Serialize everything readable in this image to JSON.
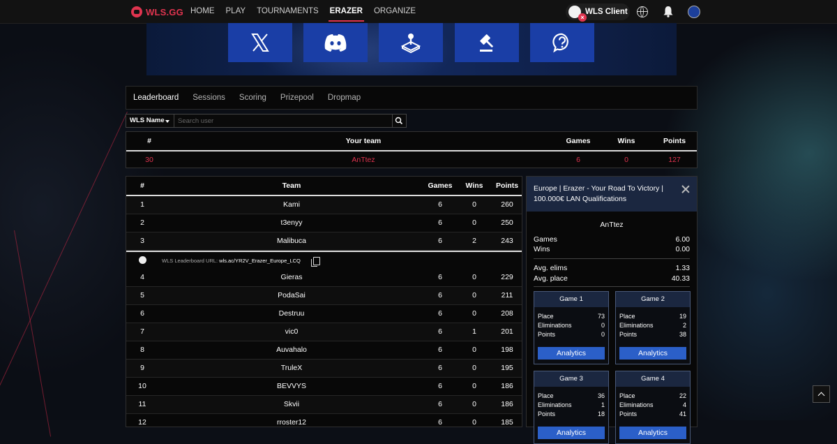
{
  "brand": {
    "name": "WLS.GG"
  },
  "nav": {
    "links": [
      "HOME",
      "PLAY",
      "TOURNAMENTS",
      "ERAZER",
      "ORGANIZE"
    ],
    "active": "ERAZER",
    "client_label": "WLS Client"
  },
  "banner": {
    "socials": [
      "x-twitter-icon",
      "discord-icon",
      "joystick-icon",
      "gavel-icon",
      "help-icon"
    ]
  },
  "tabs": [
    "Leaderboard",
    "Sessions",
    "Scoring",
    "Prizepool",
    "Dropmap"
  ],
  "active_tab": "Leaderboard",
  "search": {
    "filter": "WLS Name",
    "placeholder": "Search user"
  },
  "your_team": {
    "headers": {
      "rank": "#",
      "team": "Your team",
      "games": "Games",
      "wins": "Wins",
      "points": "Points"
    },
    "row": {
      "rank": "30",
      "team": "AnTtez",
      "games": "6",
      "wins": "0",
      "points": "127"
    }
  },
  "leaderboard": {
    "headers": {
      "rank": "#",
      "team": "Team",
      "games": "Games",
      "wins": "Wins",
      "points": "Points"
    },
    "rows": [
      {
        "rank": "1",
        "team": "Kami",
        "games": "6",
        "wins": "0",
        "points": "260"
      },
      {
        "rank": "2",
        "team": "t3enyy",
        "games": "6",
        "wins": "0",
        "points": "250"
      },
      {
        "rank": "3",
        "team": "Malibuca",
        "games": "6",
        "wins": "2",
        "points": "243"
      },
      {
        "rank": "4",
        "team": "Gieras",
        "games": "6",
        "wins": "0",
        "points": "229"
      },
      {
        "rank": "5",
        "team": "PodaSai",
        "games": "6",
        "wins": "0",
        "points": "211"
      },
      {
        "rank": "6",
        "team": "Destruu",
        "games": "6",
        "wins": "0",
        "points": "208"
      },
      {
        "rank": "7",
        "team": "vic0",
        "games": "6",
        "wins": "1",
        "points": "201"
      },
      {
        "rank": "8",
        "team": "Auvahalo",
        "games": "6",
        "wins": "0",
        "points": "198"
      },
      {
        "rank": "9",
        "team": "TruleX",
        "games": "6",
        "wins": "0",
        "points": "195"
      },
      {
        "rank": "10",
        "team": "BEVVYS",
        "games": "6",
        "wins": "0",
        "points": "186"
      },
      {
        "rank": "11",
        "team": "Skvii",
        "games": "6",
        "wins": "0",
        "points": "186"
      },
      {
        "rank": "12",
        "team": "rroster12",
        "games": "6",
        "wins": "0",
        "points": "185"
      }
    ],
    "url_label": "WLS Leaderboard URL:",
    "url": "wls.ac/YR2V_Erazer_Europe_LCQ"
  },
  "panel": {
    "title": "Europe | Erazer - Your Road To Victory | 100.000€ LAN Qualifications",
    "team": "AnTtez",
    "stats": [
      {
        "label": "Games",
        "value": "6.00"
      },
      {
        "label": "Wins",
        "value": "0.00"
      },
      {
        "label": "Avg. elims",
        "value": "1.33"
      },
      {
        "label": "Avg. place",
        "value": "40.33"
      }
    ],
    "games": [
      {
        "title": "Game 1",
        "place": "73",
        "elims": "0",
        "points": "0"
      },
      {
        "title": "Game 2",
        "place": "19",
        "elims": "2",
        "points": "38"
      },
      {
        "title": "Game 3",
        "place": "36",
        "elims": "1",
        "points": "18"
      },
      {
        "title": "Game 4",
        "place": "22",
        "elims": "4",
        "points": "41"
      }
    ],
    "labels": {
      "place": "Place",
      "elims": "Eliminations",
      "points": "Points",
      "analytics": "Analytics"
    }
  },
  "colors": {
    "accent": "#e0344f",
    "primary": "#1a3ea6",
    "panel_head": "#1b2740"
  }
}
